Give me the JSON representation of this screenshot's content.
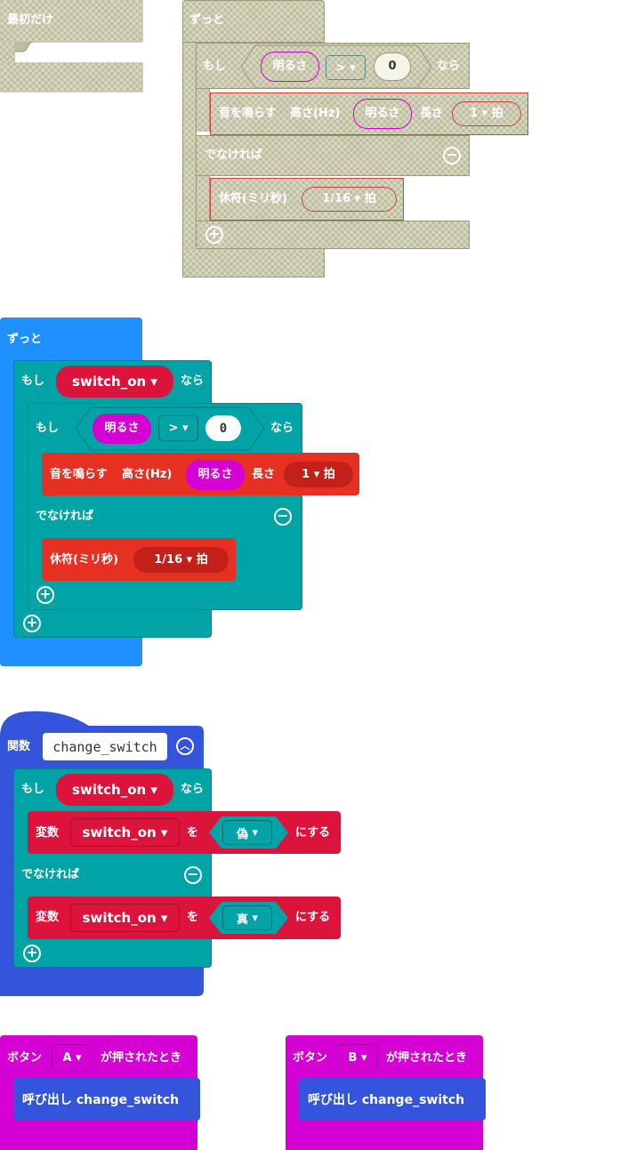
{
  "colors": {
    "disabled": "#bdbd9c",
    "forever": "#1e90ff",
    "logic": "#00a4a6",
    "music": "#e63022",
    "music_dark": "#c4201a",
    "input": "#d400d4",
    "function": "#3455db",
    "variables": "#dc143c",
    "bool_bg": "#00a4a6"
  },
  "block_on_start": {
    "label": "最初だけ"
  },
  "disabled_forever": {
    "label": "ずっと",
    "if_label": "もし",
    "lhs": "明るさ",
    "op": ">",
    "rhs": "0",
    "then_label": "なら",
    "tone_label": "音を鳴らす",
    "freq_label": "高さ(Hz)",
    "freq_value": "明るさ",
    "len_label": "長さ",
    "len_value": "1",
    "beat": "拍",
    "else_label": "でなければ",
    "rest_label": "休符(ミリ秒)",
    "rest_value": "1/16",
    "rest_beat": "拍"
  },
  "forever": {
    "label": "ずっと",
    "if_label": "もし",
    "var": "switch_on",
    "then_label": "なら",
    "inner_if": "もし",
    "lhs": "明るさ",
    "op": ">",
    "rhs": "0",
    "inner_then": "なら",
    "tone_label": "音を鳴らす",
    "freq_label": "高さ(Hz)",
    "freq_value": "明るさ",
    "len_label": "長さ",
    "len_value": "1",
    "beat": "拍",
    "else_label": "でなければ",
    "rest_label": "休符(ミリ秒)",
    "rest_value": "1/16",
    "rest_beat": "拍"
  },
  "function": {
    "label": "関数",
    "name": "change_switch",
    "if_label": "もし",
    "var": "switch_on",
    "then_label": "なら",
    "set_label": "変数",
    "set_var": "switch_on",
    "to_label": "を",
    "false_val": "偽",
    "suffix": "にする",
    "else_label": "でなければ",
    "set_label2": "変数",
    "set_var2": "switch_on",
    "to_label2": "を",
    "true_val": "真",
    "suffix2": "にする"
  },
  "button_a": {
    "label": "ボタン",
    "button": "A",
    "event": "が押されたとき",
    "call": "呼び出し change_switch"
  },
  "button_b": {
    "label": "ボタン",
    "button": "B",
    "event": "が押されたとき",
    "call": "呼び出し change_switch"
  }
}
